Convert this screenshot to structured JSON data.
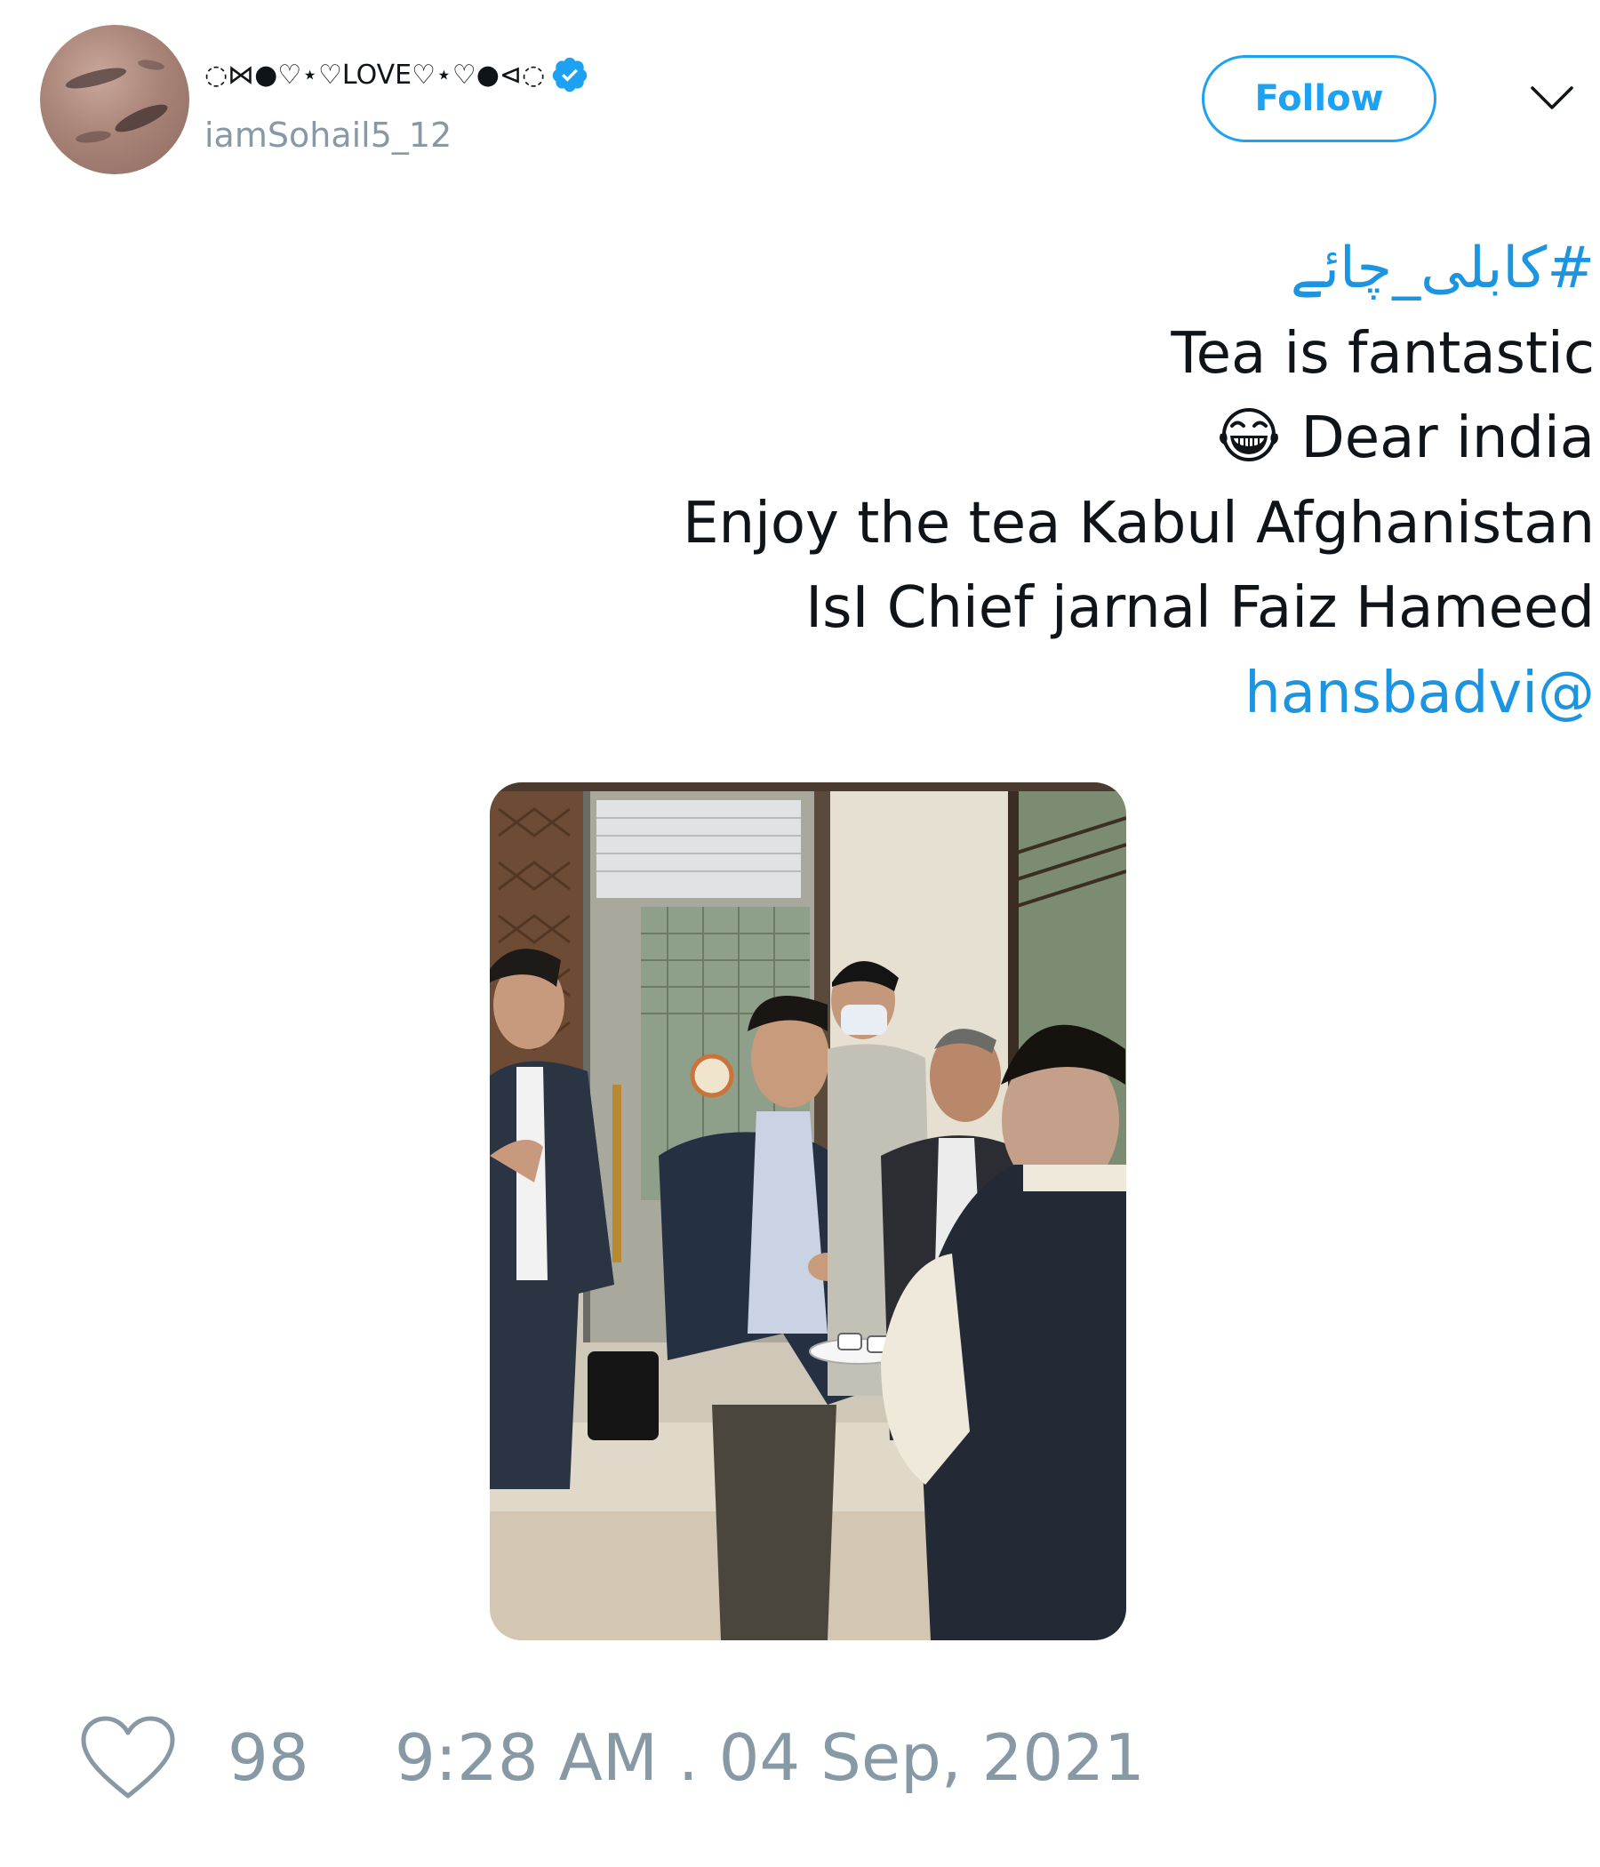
{
  "author": {
    "display_name": "◌⋈●♡⋆♡LOVE♡⋆♡●⊲◌",
    "handle": "iamSohail5_12",
    "verified": true,
    "avatar_icon": "avatar-photo"
  },
  "actions": {
    "follow_label": "Follow",
    "more_icon": "chevron-down-icon"
  },
  "tweet": {
    "hashtag": "#کابلی_چائے",
    "line1": "Tea is fantastic",
    "line2_emoji": "grinning-face-with-tears-emoji",
    "line2": "Dear india",
    "line3": "Enjoy the tea Kabul Afghanistan",
    "line4": "IsI Chief jarnal Faiz Hameed",
    "mention": "hansbadvi@"
  },
  "media": {
    "type": "photo",
    "alt": "photo"
  },
  "footer": {
    "like_icon": "heart-icon",
    "like_count": "98",
    "timestamp": "9:28 AM . 04 Sep, 2021"
  },
  "colors": {
    "accent": "#1da1f2",
    "link": "#1b95e0",
    "muted": "#8899a6",
    "text": "#0f1419"
  }
}
